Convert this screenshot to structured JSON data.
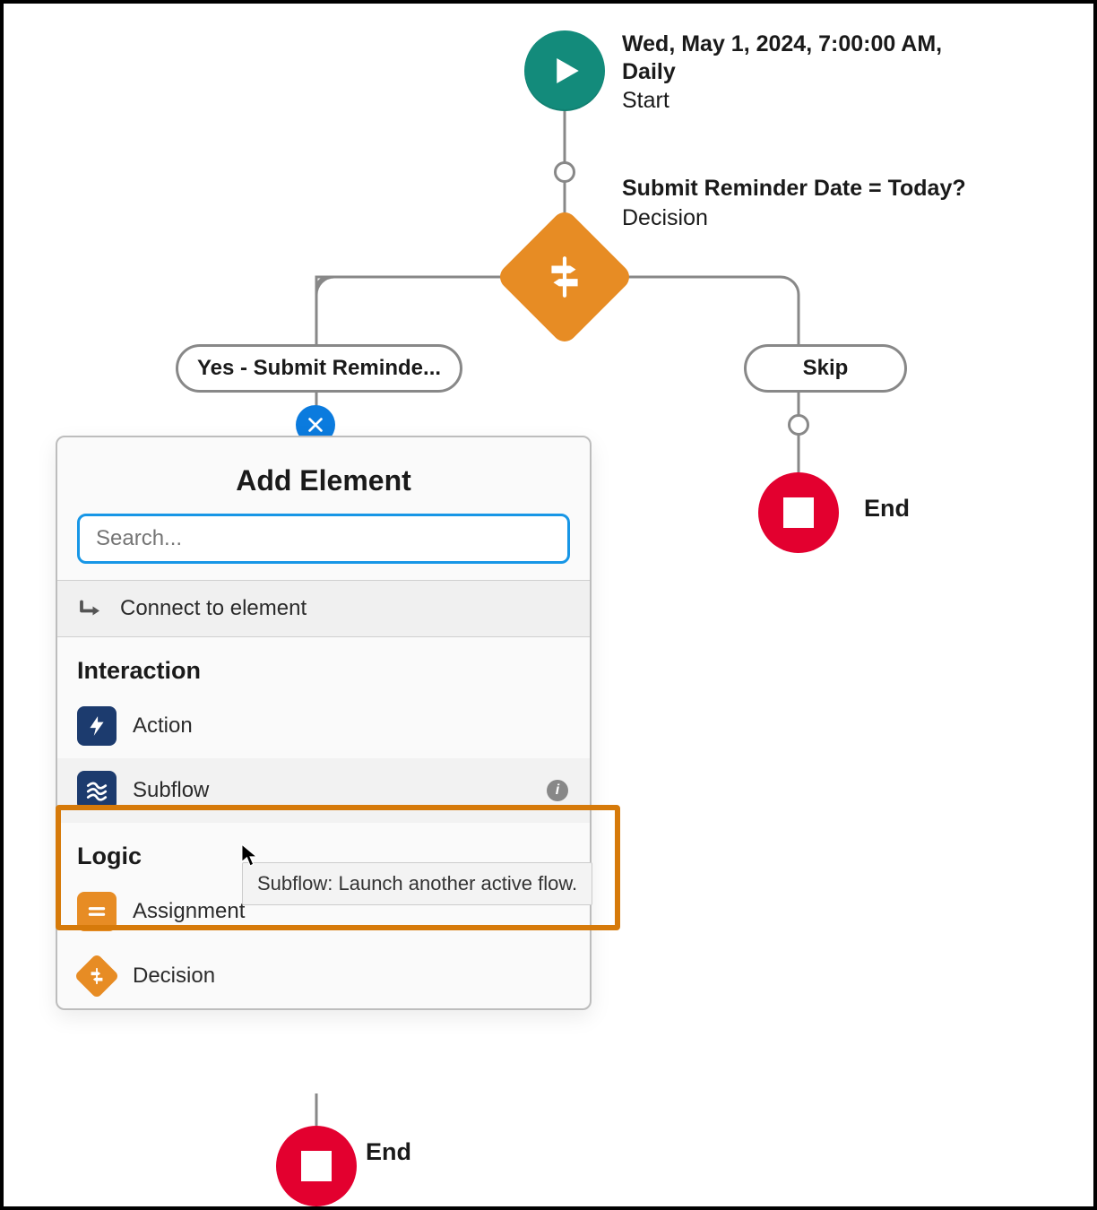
{
  "start": {
    "line1": "Wed, May 1, 2024, 7:00:00 AM,",
    "line2": "Daily",
    "type": "Start"
  },
  "decision": {
    "question": "Submit Reminder Date = Today?",
    "type": "Decision"
  },
  "branches": {
    "left": "Yes - Submit Reminde...",
    "right": "Skip"
  },
  "end": {
    "label": "End"
  },
  "popover": {
    "title": "Add Element",
    "searchPlaceholder": "Search...",
    "connect": "Connect to element",
    "sections": {
      "interaction": "Interaction",
      "logic": "Logic"
    },
    "items": {
      "action": "Action",
      "subflow": "Subflow",
      "assignment": "Assignment",
      "decision": "Decision"
    }
  },
  "tooltip": "Subflow: Launch another active flow."
}
